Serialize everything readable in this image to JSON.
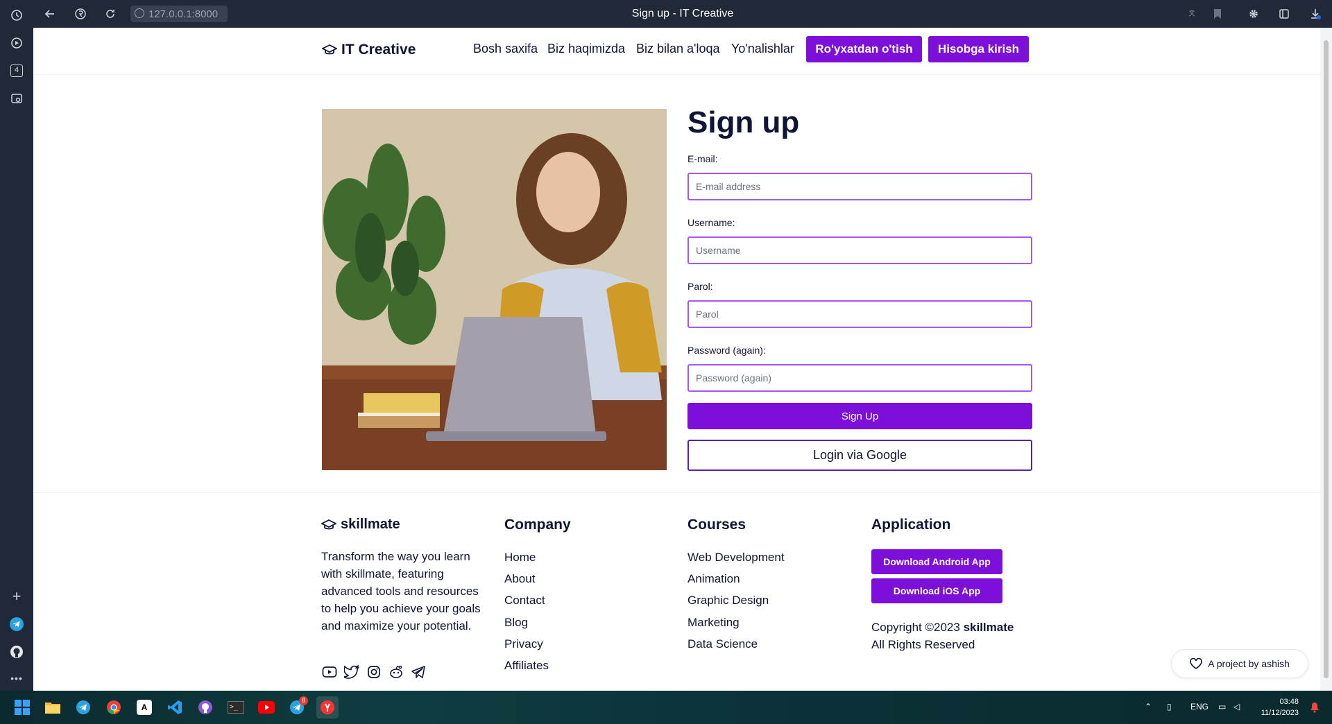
{
  "browser": {
    "url": "127.0.0.1:8000",
    "page_title": "Sign up - IT Creative",
    "sidebar_badge": "4"
  },
  "header": {
    "logo_text": "IT Creative",
    "nav": [
      "Bosh saxifa",
      "Biz haqimizda",
      "Biz bilan a'loqa",
      "Yo'nalishlar"
    ],
    "register_button": "Ro'yxatdan o'tish",
    "login_button": "Hisobga kirish"
  },
  "form": {
    "title": "Sign up",
    "email_label": "E-mail:",
    "email_placeholder": "E-mail address",
    "username_label": "Username:",
    "username_placeholder": "Username",
    "password_label": "Parol:",
    "password_placeholder": "Parol",
    "password2_label": "Password (again):",
    "password2_placeholder": "Password (again)",
    "submit_label": "Sign Up",
    "google_label": "Login via Google"
  },
  "footer": {
    "brand": "skillmate",
    "description": "Transform the way you learn with skillmate, featuring advanced tools and resources to help you achieve your goals and maximize your potential.",
    "company_heading": "Company",
    "company_links": [
      "Home",
      "About",
      "Contact",
      "Blog",
      "Privacy",
      "Affiliates"
    ],
    "courses_heading": "Courses",
    "courses_links": [
      "Web Development",
      "Animation",
      "Graphic Design",
      "Marketing",
      "Data Science"
    ],
    "application_heading": "Application",
    "android_button": "Download Android App",
    "ios_button": "Download iOS App",
    "copyright_prefix": "Copyright ©2023",
    "copyright_brand": "skillmate",
    "rights": "All Rights Reserved",
    "project_prefix": "A project by",
    "project_author": "ashish"
  },
  "taskbar": {
    "language": "ENG",
    "time": "03:48",
    "date": "11/12/2023",
    "telegram_badge": "8"
  },
  "colors": {
    "accent": "#7c10d8",
    "text": "#0f1535",
    "browser_chrome": "#1f2937"
  }
}
